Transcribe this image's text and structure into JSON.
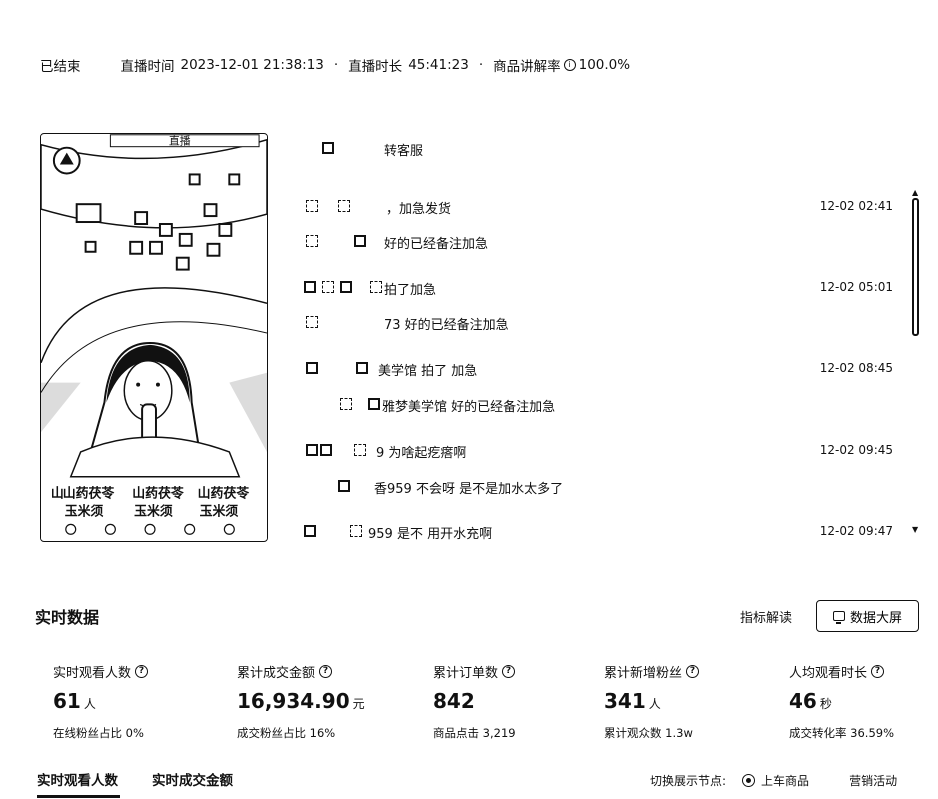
{
  "status": {
    "state": "已结束",
    "start_label": "直播时间",
    "start_value": "2023-12-01 21:38:13",
    "duration_label": "直播时长",
    "duration_value": "45:41:23",
    "explain_rate_label": "商品讲解率",
    "explain_rate_value": "100.0%"
  },
  "comments": [
    {
      "msg": "转客服",
      "time": ""
    },
    {
      "msg": "，加急发货",
      "time": "12-02 02:41"
    },
    {
      "msg": "好的已经备注加急",
      "time": ""
    },
    {
      "msg": "拍了加急",
      "time": "12-02 05:01"
    },
    {
      "msg": "73 好的已经备注加急",
      "time": ""
    },
    {
      "msg": "美学馆  拍了 加急",
      "time": "12-02 08:45"
    },
    {
      "msg": "雅梦美学馆 好的已经备注加急",
      "time": ""
    },
    {
      "msg": "9   为啥起疙瘩啊",
      "time": "12-02 09:45"
    },
    {
      "msg": "香959 不会呀 是不是加水太多了",
      "time": ""
    },
    {
      "msg": "959   是不 用开水充啊",
      "time": "12-02 09:47"
    }
  ],
  "realtime": {
    "title": "实时数据",
    "indicator_link": "指标解读",
    "big_screen_button": "数据大屏",
    "metrics": [
      {
        "label": "实时观看人数",
        "value": "61",
        "unit": "人",
        "sub": "在线粉丝占比 0%"
      },
      {
        "label": "累计成交金额",
        "value": "16,934.90",
        "unit": "元",
        "sub": "成交粉丝占比 16%"
      },
      {
        "label": "累计订单数",
        "value": "842",
        "unit": "",
        "sub": "商品点击 3,219"
      },
      {
        "label": "累计新增粉丝",
        "value": "341",
        "unit": "人",
        "sub": "累计观众数 1.3w"
      },
      {
        "label": "人均观看时长",
        "value": "46",
        "unit": "秒",
        "sub": "成交转化率 36.59%"
      }
    ]
  },
  "tabs": [
    {
      "label": "实时观看人数",
      "active": true
    },
    {
      "label": "实时成交金额",
      "active": false
    }
  ],
  "switch_nodes": {
    "label": "切换展示节点:",
    "options": [
      "上车商品",
      "营销活动"
    ]
  },
  "thumbnail": {
    "texts": [
      "直播",
      "山药茯苓",
      "玉米须",
      "山药茯苓",
      "玉米须",
      "山药茯苓",
      "玉米须"
    ]
  }
}
